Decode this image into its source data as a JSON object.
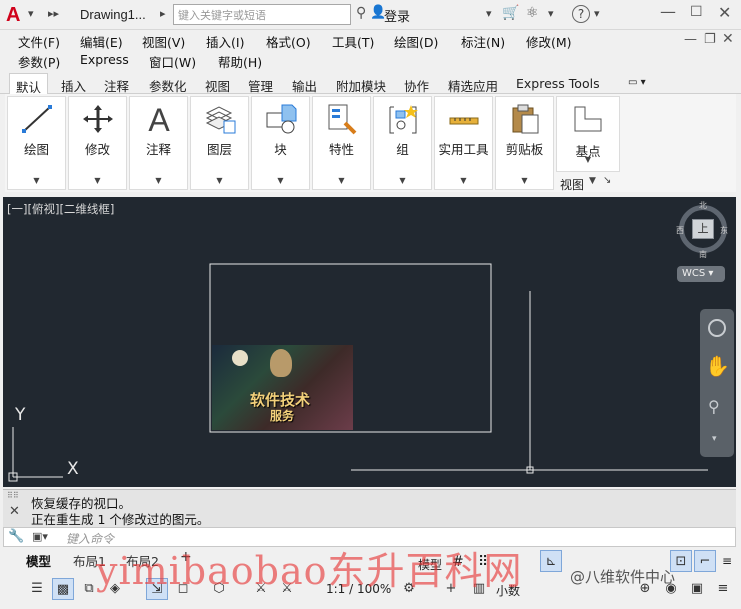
{
  "titlebar": {
    "logo": "A",
    "doc_title": "Drawing1...",
    "search_placeholder": "键入关键字或短语",
    "login": "登录",
    "help": "?"
  },
  "menubar": {
    "row1": [
      "文件(F)",
      "编辑(E)",
      "视图(V)",
      "插入(I)",
      "格式(O)",
      "工具(T)",
      "绘图(D)",
      "标注(N)",
      "修改(M)"
    ],
    "row2": [
      "参数(P)",
      "Express",
      "窗口(W)",
      "帮助(H)"
    ]
  },
  "ribbon_tabs": [
    "默认",
    "插入",
    "注释",
    "参数化",
    "视图",
    "管理",
    "输出",
    "附加模块",
    "协作",
    "精选应用",
    "Express Tools"
  ],
  "ribbon_panels": [
    "绘图",
    "修改",
    "注释",
    "图层",
    "块",
    "特性",
    "组",
    "实用工具",
    "剪贴板"
  ],
  "view_panel": {
    "button": "基点",
    "footer": "视图"
  },
  "canvas": {
    "viewport_label": "[一][俯视][二维线框]",
    "viewcube_label": "上",
    "compass": [
      "北",
      "东",
      "南",
      "西"
    ],
    "wcs": "WCS",
    "ucs_y": "Y",
    "ucs_x": "X",
    "image_caption_1": "软件技术",
    "image_caption_2": "服务"
  },
  "command": {
    "line1": "恢复缓存的视口。",
    "line2": "正在重生成 1 个修改过的图元。",
    "input_placeholder": "键入命令"
  },
  "layout_tabs": [
    "模型",
    "布局1",
    "布局2"
  ],
  "statusbar": {
    "model_label": "模型",
    "scale": "1:1 / 100%",
    "units": "小数"
  },
  "watermark": {
    "main": "yimibaobao东升百科网",
    "small": "@八维软件中心"
  }
}
